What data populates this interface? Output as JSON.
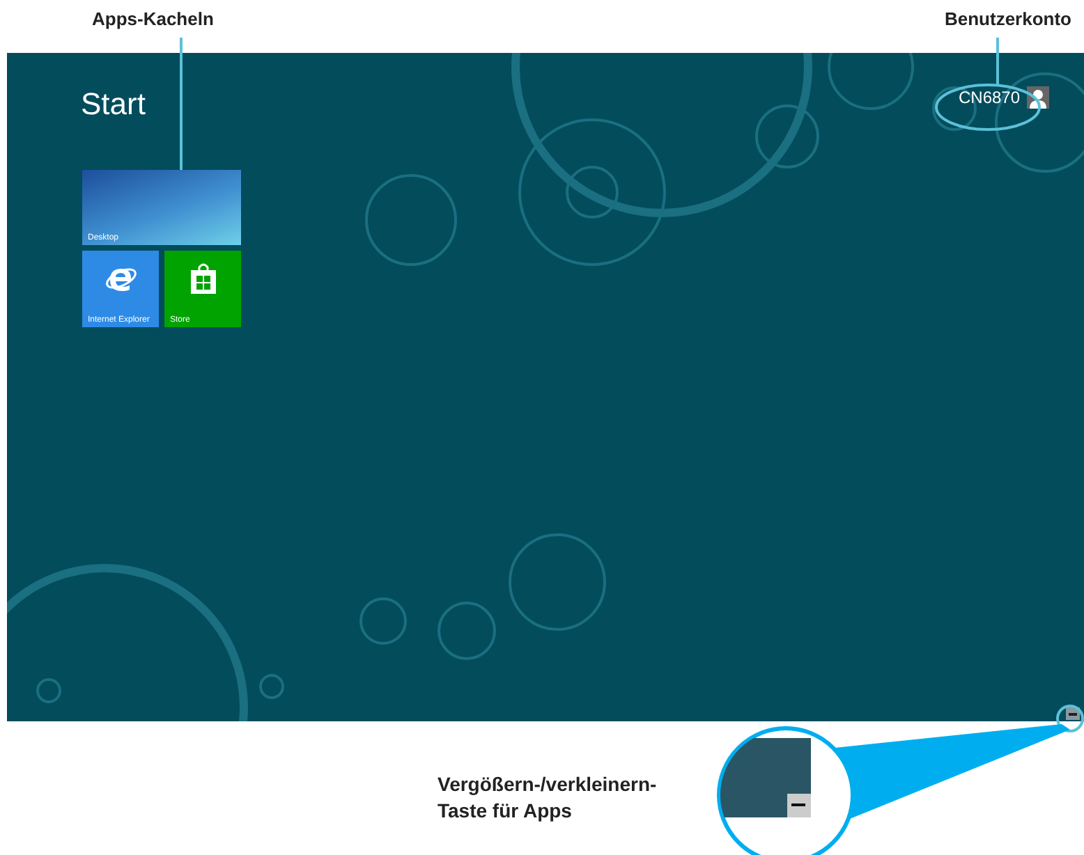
{
  "annotations": {
    "tiles_label": "Apps-Kacheln",
    "account_label": "Benutzerkonto",
    "zoom_label": "Vergößern-/verkleinern-\nTaste für Apps"
  },
  "screen": {
    "title": "Start",
    "user": {
      "name": "CN6870"
    },
    "tiles": [
      {
        "kind": "wide",
        "label": "Desktop"
      },
      {
        "kind": "browser",
        "label": "Internet Explorer"
      },
      {
        "kind": "store",
        "label": "Store"
      }
    ]
  }
}
